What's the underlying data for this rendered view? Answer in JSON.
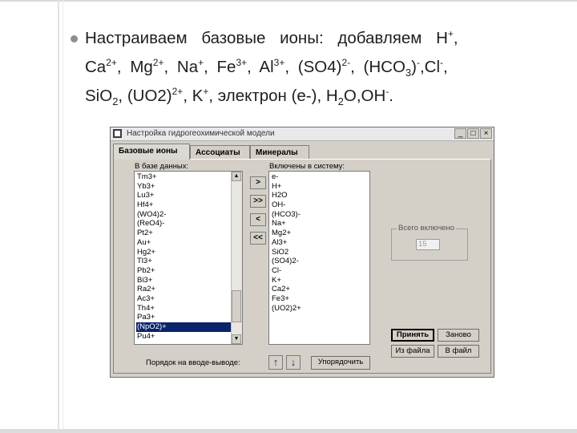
{
  "slide": {
    "line1": {
      "a": "Настраиваем базовые ионы: добавляем H",
      "a_sup": "+",
      "b": ","
    },
    "line2": {
      "ca": "Ca",
      "ca_sup": "2+",
      "c1": ", ",
      "mg": "Mg",
      "mg_sup": "2+",
      "c2": ", ",
      "na": "Na",
      "na_sup": "+",
      "c3": ", ",
      "fe": "Fe",
      "fe_sup": "3+",
      "c4": ", ",
      "al": "Al",
      "al_sup": "3+",
      "c5": ", ",
      "so4": "(SO4)",
      "so4_sup": "2-",
      "c6": ", ",
      "hco": "(HCO",
      "hco_sub": "3",
      "hco_close": ")",
      "hco_sup": "-",
      "c7": ",Cl",
      "cl_sup": "-",
      "c8": ","
    },
    "line3": {
      "si": "SiO",
      "si_sub": "2",
      "c1": ", (UO2)",
      "uo_sup": "2+",
      "c2": ", K",
      "k_sup": "+",
      "c3": ", электрон (e-), H",
      "h_sub": "2",
      "c4": "O,OH",
      "oh_sup": "-",
      "c5": "."
    }
  },
  "window": {
    "title": "Настройка гидрогеохимической модели",
    "controls": {
      "min": "_",
      "max": "□",
      "close": "×"
    },
    "tabs": [
      "Базовые ионы",
      "Ассоциаты",
      "Минералы"
    ],
    "left_label": "В базе данных:",
    "right_label": "Включены в систему:",
    "db_items": [
      "Tm3+",
      "Yb3+",
      "Lu3+",
      "Hf4+",
      "(WO4)2-",
      "(ReO4)-",
      "Pt2+",
      "Au+",
      "Hg2+",
      "Tl3+",
      "Pb2+",
      "Bi3+",
      "Ra2+",
      "Ac3+",
      "Th4+",
      "Pa3+",
      "(NpO2)+",
      "Pu4+"
    ],
    "db_selected": "(NpO2)+",
    "system_items": [
      "e-",
      "H+",
      "H2O",
      "OH-",
      "(HCO3)-",
      "Na+",
      "Mg2+",
      "Al3+",
      "SiO2",
      "(SO4)2-",
      "Cl-",
      "K+",
      "Ca2+",
      "Fe3+",
      "(UO2)2+"
    ],
    "move_buttons": [
      ">",
      ">>",
      "<",
      "<<"
    ],
    "total_label": "Всего включено",
    "total_value": "15",
    "buttons": {
      "accept": "Принять",
      "reset": "Заново",
      "from_file": "Из файла",
      "to_file": "В файл"
    },
    "order_label": "Порядок на вводе-выводе:",
    "order_up": "↑",
    "order_down": "↓",
    "order_button": "Упорядочить"
  }
}
